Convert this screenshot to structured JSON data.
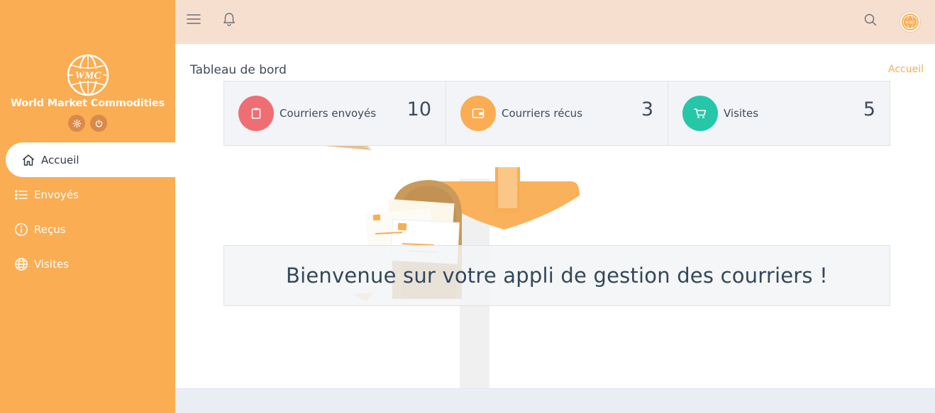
{
  "brand": {
    "logo_text": "WMC",
    "name": "World Market Commodities"
  },
  "sidebar": {
    "items": [
      {
        "label": "Accueil",
        "icon": "home-icon",
        "active": true
      },
      {
        "label": "Envoyés",
        "icon": "list-icon"
      },
      {
        "label": "Reçus",
        "icon": "info-icon"
      },
      {
        "label": "Visites",
        "icon": "globe-icon"
      }
    ]
  },
  "topbar": {
    "icons": [
      "menu-icon",
      "bell-icon",
      "search-icon",
      "avatar"
    ]
  },
  "page": {
    "title": "Tableau de bord",
    "breadcrumb": "Accueil"
  },
  "stats": [
    {
      "label": "Courriers envoyés",
      "value": "10",
      "color": "#ee6e73",
      "icon": "clipboard-icon"
    },
    {
      "label": "Courriers récus",
      "value": "3",
      "color": "#faad52",
      "icon": "wallet-icon"
    },
    {
      "label": "Visites",
      "value": "5",
      "color": "#26c6a9",
      "icon": "cart-icon"
    }
  ],
  "welcome": "Bienvenue sur votre appli de gestion des courriers !",
  "colors": {
    "sidebar": "#faad52",
    "topbar": "#f7dfd0",
    "accent": "#faad52"
  }
}
